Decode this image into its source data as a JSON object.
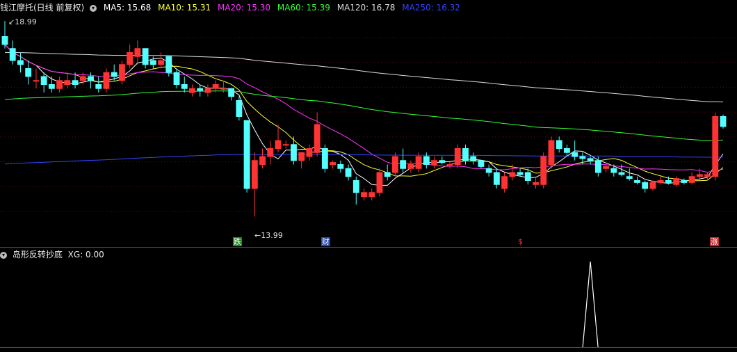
{
  "header": {
    "title": "钱江摩托(日线 前复权)",
    "ma": [
      {
        "label": "MA5: 15.68",
        "color": "#ffffff"
      },
      {
        "label": "MA10: 15.31",
        "color": "#ffff33"
      },
      {
        "label": "MA20: 15.30",
        "color": "#ff33ff"
      },
      {
        "label": "MA60: 15.39",
        "color": "#33ff33"
      },
      {
        "label": "MA120: 16.78",
        "color": "#dddddd"
      },
      {
        "label": "MA250: 16.32",
        "color": "#3344ff"
      }
    ]
  },
  "indicator": {
    "title": "岛形反转抄底",
    "xg_label": "XG: 0.00"
  },
  "annotations": {
    "high_label": "18.99",
    "low_label": "13.99"
  },
  "badges": [
    {
      "text": "跌",
      "color": "#ffffff",
      "bg": "#1d8a1d"
    },
    {
      "text": "财",
      "color": "#ffffff",
      "bg": "#2244aa"
    },
    {
      "text": "$",
      "color": "#ff3333",
      "bg": ""
    },
    {
      "text": "涨",
      "color": "#ffffff",
      "bg": "#c0282e"
    }
  ],
  "chart_data": {
    "type": "candlestick",
    "ylim": [
      13.6,
      19.2
    ],
    "candles": [
      [
        18.6,
        18.99,
        18.3,
        18.4
      ],
      [
        18.3,
        18.5,
        17.9,
        18.0
      ],
      [
        18.0,
        18.2,
        17.7,
        17.9
      ],
      [
        17.8,
        18.0,
        17.4,
        17.6
      ],
      [
        17.5,
        17.8,
        17.3,
        17.5
      ],
      [
        17.6,
        17.7,
        17.2,
        17.4
      ],
      [
        17.4,
        17.6,
        17.2,
        17.3
      ],
      [
        17.3,
        17.6,
        17.2,
        17.5
      ],
      [
        17.4,
        17.7,
        17.3,
        17.5
      ],
      [
        17.5,
        17.7,
        17.3,
        17.4
      ],
      [
        17.5,
        17.7,
        17.4,
        17.6
      ],
      [
        17.6,
        17.7,
        17.3,
        17.5
      ],
      [
        17.4,
        17.6,
        17.2,
        17.3
      ],
      [
        17.3,
        17.8,
        17.2,
        17.7
      ],
      [
        17.7,
        17.9,
        17.5,
        17.6
      ],
      [
        17.5,
        18.0,
        17.4,
        17.9
      ],
      [
        17.9,
        18.4,
        17.8,
        18.2
      ],
      [
        18.1,
        18.5,
        17.9,
        18.3
      ],
      [
        18.3,
        18.3,
        17.8,
        17.9
      ],
      [
        18.0,
        18.1,
        17.8,
        17.9
      ],
      [
        17.9,
        18.2,
        17.8,
        18.0
      ],
      [
        18.1,
        18.1,
        17.6,
        17.7
      ],
      [
        17.7,
        17.8,
        17.3,
        17.4
      ],
      [
        17.4,
        17.6,
        17.2,
        17.3
      ],
      [
        17.2,
        17.4,
        17.1,
        17.3
      ],
      [
        17.3,
        17.4,
        17.1,
        17.25
      ],
      [
        17.2,
        17.4,
        17.1,
        17.3
      ],
      [
        17.3,
        17.5,
        17.2,
        17.4
      ],
      [
        17.3,
        17.5,
        17.2,
        17.3
      ],
      [
        17.3,
        17.3,
        17.0,
        17.1
      ],
      [
        17.0,
        17.1,
        16.5,
        16.6
      ],
      [
        16.5,
        16.5,
        14.7,
        14.8
      ],
      [
        14.8,
        15.7,
        14.1,
        15.5
      ],
      [
        15.4,
        15.8,
        15.3,
        15.6
      ],
      [
        15.6,
        16.0,
        15.4,
        15.8
      ],
      [
        15.8,
        16.4,
        15.7,
        16.0
      ],
      [
        15.9,
        16.0,
        15.8,
        15.9
      ],
      [
        15.9,
        16.1,
        15.4,
        15.5
      ],
      [
        15.5,
        15.7,
        15.3,
        15.7
      ],
      [
        15.6,
        15.9,
        15.5,
        15.8
      ],
      [
        15.7,
        16.7,
        15.6,
        16.4
      ],
      [
        15.8,
        15.9,
        15.2,
        15.3
      ],
      [
        15.4,
        15.5,
        15.3,
        15.45
      ],
      [
        15.4,
        15.5,
        15.2,
        15.3
      ],
      [
        15.3,
        15.4,
        15.0,
        15.1
      ],
      [
        15.0,
        15.1,
        14.4,
        14.7
      ],
      [
        14.6,
        14.8,
        14.5,
        14.7
      ],
      [
        14.6,
        14.8,
        14.5,
        14.7
      ],
      [
        14.7,
        15.3,
        14.6,
        15.2
      ],
      [
        15.2,
        15.4,
        15.0,
        15.1
      ],
      [
        15.2,
        15.7,
        15.1,
        15.6
      ],
      [
        15.5,
        15.8,
        15.2,
        15.3
      ],
      [
        15.3,
        15.5,
        15.2,
        15.4
      ],
      [
        15.3,
        15.7,
        15.2,
        15.6
      ],
      [
        15.6,
        15.7,
        15.3,
        15.4
      ],
      [
        15.4,
        15.6,
        15.3,
        15.5
      ],
      [
        15.5,
        15.6,
        15.4,
        15.45
      ],
      [
        15.4,
        15.5,
        15.3,
        15.4
      ],
      [
        15.4,
        15.9,
        15.3,
        15.8
      ],
      [
        15.8,
        15.9,
        15.4,
        15.5
      ],
      [
        15.6,
        15.7,
        15.4,
        15.5
      ],
      [
        15.5,
        15.5,
        15.3,
        15.35
      ],
      [
        15.3,
        15.4,
        15.1,
        15.2
      ],
      [
        15.2,
        15.3,
        14.8,
        14.9
      ],
      [
        14.8,
        15.2,
        14.7,
        15.1
      ],
      [
        15.1,
        15.4,
        15.0,
        15.2
      ],
      [
        15.2,
        15.3,
        15.1,
        15.15
      ],
      [
        15.2,
        15.3,
        14.9,
        15.0
      ],
      [
        14.9,
        15.1,
        14.8,
        14.95
      ],
      [
        14.9,
        15.7,
        14.8,
        15.6
      ],
      [
        15.4,
        16.1,
        15.3,
        16.0
      ],
      [
        16.0,
        16.1,
        15.7,
        15.8
      ],
      [
        15.8,
        15.9,
        15.6,
        15.7
      ],
      [
        15.7,
        16.0,
        15.5,
        15.6
      ],
      [
        15.6,
        15.7,
        15.4,
        15.55
      ],
      [
        15.55,
        15.6,
        15.4,
        15.5
      ],
      [
        15.5,
        15.6,
        15.1,
        15.2
      ],
      [
        15.3,
        15.4,
        15.2,
        15.35
      ],
      [
        15.3,
        15.4,
        15.1,
        15.2
      ],
      [
        15.2,
        15.4,
        15.1,
        15.15
      ],
      [
        15.1,
        15.3,
        15.0,
        15.05
      ],
      [
        15.0,
        15.1,
        14.9,
        14.95
      ],
      [
        14.95,
        15.0,
        14.7,
        14.8
      ],
      [
        14.8,
        15.0,
        14.75,
        14.95
      ],
      [
        14.95,
        15.1,
        14.9,
        15.0
      ],
      [
        15.0,
        15.1,
        14.9,
        14.95
      ],
      [
        14.9,
        15.1,
        14.85,
        15.05
      ],
      [
        15.0,
        15.05,
        14.9,
        14.95
      ],
      [
        14.95,
        15.2,
        14.9,
        15.1
      ],
      [
        15.1,
        15.3,
        15.0,
        15.15
      ],
      [
        15.1,
        15.2,
        15.0,
        15.15
      ],
      [
        15.1,
        16.7,
        15.0,
        16.6
      ],
      [
        16.6,
        16.65,
        16.3,
        16.35
      ]
    ],
    "xg_signal_index": 75
  }
}
